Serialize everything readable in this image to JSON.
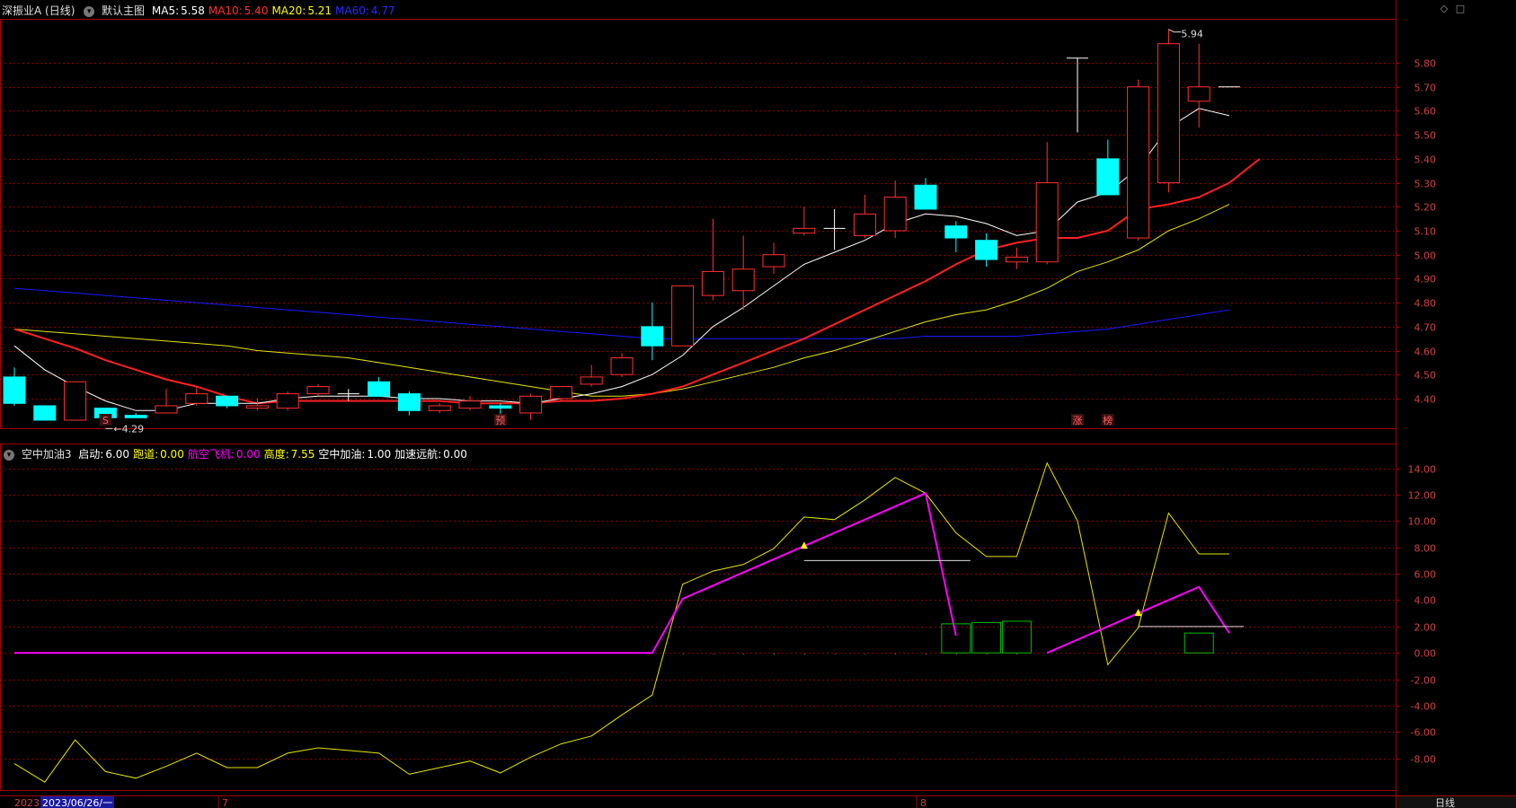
{
  "header": {
    "stock": "深振业A (日线)",
    "template": "默认主图",
    "ma": [
      {
        "label": "MA5:",
        "value": "5.58",
        "color": "#ffffff"
      },
      {
        "label": "MA10:",
        "value": "5.40",
        "color": "#ff3030"
      },
      {
        "label": "MA20:",
        "value": "5.21",
        "color": "#ffff00"
      },
      {
        "label": "MA60:",
        "value": "4.77",
        "color": "#2a2aff"
      }
    ]
  },
  "indicator_header": {
    "name": "空中加油3",
    "items": [
      {
        "label": "启动:",
        "value": "6.00",
        "color": "#ffffff"
      },
      {
        "label": "跑道:",
        "value": "0.00",
        "color": "#ffff00"
      },
      {
        "label": "航空飞机:",
        "value": "0.00",
        "color": "#ff00ff"
      },
      {
        "label": "高度:",
        "value": "7.55",
        "color": "#ffff00"
      },
      {
        "label": "空中加油:",
        "value": "1.00",
        "color": "#ffffff"
      },
      {
        "label": "加速远航:",
        "value": "0.00",
        "color": "#ffffff"
      }
    ]
  },
  "chart_data": [
    {
      "type": "candlestick",
      "ylim": [
        4.28,
        5.98
      ],
      "yticks": [
        "5.80",
        "5.70",
        "5.60",
        "5.50",
        "5.40",
        "5.30",
        "5.20",
        "5.10",
        "5.00",
        "4.90",
        "4.80",
        "4.70",
        "4.60",
        "4.50",
        "4.40"
      ],
      "candles": [
        [
          4.49,
          4.38,
          4.53,
          4.37
        ],
        [
          4.37,
          4.31,
          4.37,
          4.31
        ],
        [
          4.31,
          4.47,
          4.47,
          4.31
        ],
        [
          4.36,
          4.32,
          4.36,
          4.32
        ],
        [
          4.33,
          4.32,
          4.34,
          4.32
        ],
        [
          4.34,
          4.37,
          4.44,
          4.34
        ],
        [
          4.38,
          4.42,
          4.45,
          4.37
        ],
        [
          4.41,
          4.37,
          4.41,
          4.36
        ],
        [
          4.36,
          4.37,
          4.4,
          4.35
        ],
        [
          4.36,
          4.42,
          4.43,
          4.35
        ],
        [
          4.42,
          4.45,
          4.46,
          4.41
        ],
        [
          4.42,
          4.42,
          4.44,
          4.39
        ],
        [
          4.47,
          4.41,
          4.49,
          4.41
        ],
        [
          4.42,
          4.35,
          4.43,
          4.33
        ],
        [
          4.35,
          4.37,
          4.38,
          4.34
        ],
        [
          4.36,
          4.39,
          4.41,
          4.35
        ],
        [
          4.37,
          4.36,
          4.38,
          4.31
        ],
        [
          4.34,
          4.41,
          4.42,
          4.31
        ],
        [
          4.4,
          4.45,
          4.45,
          4.39
        ],
        [
          4.46,
          4.49,
          4.54,
          4.45
        ],
        [
          4.5,
          4.57,
          4.59,
          4.49
        ],
        [
          4.7,
          4.62,
          4.8,
          4.56
        ],
        [
          4.62,
          4.87,
          4.87,
          4.62
        ],
        [
          4.83,
          4.93,
          5.15,
          4.81
        ],
        [
          4.85,
          4.94,
          5.08,
          4.77
        ],
        [
          4.95,
          5.0,
          5.05,
          4.92
        ],
        [
          5.09,
          5.11,
          5.2,
          5.08
        ],
        [
          5.11,
          5.11,
          5.19,
          5.02
        ],
        [
          5.08,
          5.17,
          5.25,
          5.07
        ],
        [
          5.1,
          5.24,
          5.31,
          5.07
        ],
        [
          5.29,
          5.19,
          5.32,
          5.19
        ],
        [
          5.12,
          5.07,
          5.14,
          5.01
        ],
        [
          5.06,
          4.98,
          5.09,
          4.95
        ],
        [
          4.97,
          4.99,
          5.03,
          4.94
        ],
        [
          4.97,
          5.3,
          5.47,
          4.96
        ],
        [
          5.82,
          5.82,
          5.82,
          5.51
        ],
        [
          5.4,
          5.25,
          5.48,
          5.25
        ],
        [
          5.07,
          5.7,
          5.73,
          5.06
        ],
        [
          5.3,
          5.88,
          5.94,
          5.26
        ],
        [
          5.64,
          5.7,
          5.88,
          5.53
        ],
        [
          5.7,
          5.7,
          5.7,
          5.7
        ]
      ],
      "ma5": [
        4.62,
        4.52,
        4.45,
        4.39,
        4.35,
        4.35,
        4.38,
        4.38,
        4.38,
        4.4,
        4.41,
        4.41,
        4.41,
        4.4,
        4.4,
        4.39,
        4.39,
        4.38,
        4.4,
        4.42,
        4.45,
        4.5,
        4.58,
        4.7,
        4.78,
        4.87,
        4.96,
        5.01,
        5.06,
        5.13,
        5.17,
        5.16,
        5.13,
        5.08,
        5.1,
        5.22,
        5.26,
        5.36,
        5.53,
        5.61,
        5.58
      ],
      "ma10": [
        4.69,
        4.65,
        4.61,
        4.56,
        4.52,
        4.48,
        4.45,
        4.41,
        4.38,
        4.39,
        4.39,
        4.39,
        4.39,
        4.39,
        4.39,
        4.38,
        4.38,
        4.38,
        4.39,
        4.39,
        4.4,
        4.42,
        4.45,
        4.5,
        4.55,
        4.6,
        4.65,
        4.71,
        4.77,
        4.83,
        4.89,
        4.96,
        5.02,
        5.05,
        5.07,
        5.07,
        5.1,
        5.19,
        5.21,
        5.24,
        5.3,
        5.4
      ],
      "ma20": [
        4.69,
        4.68,
        4.67,
        4.66,
        4.65,
        4.64,
        4.63,
        4.62,
        4.6,
        4.59,
        4.58,
        4.57,
        4.55,
        4.53,
        4.51,
        4.49,
        4.47,
        4.45,
        4.43,
        4.41,
        4.41,
        4.42,
        4.44,
        4.47,
        4.5,
        4.53,
        4.57,
        4.6,
        4.64,
        4.68,
        4.72,
        4.75,
        4.77,
        4.81,
        4.86,
        4.93,
        4.97,
        5.02,
        5.1,
        5.15,
        5.21
      ],
      "ma60": [
        4.86,
        4.85,
        4.84,
        4.83,
        4.82,
        4.81,
        4.8,
        4.79,
        4.78,
        4.77,
        4.76,
        4.75,
        4.74,
        4.73,
        4.72,
        4.71,
        4.7,
        4.69,
        4.68,
        4.67,
        4.66,
        4.65,
        4.65,
        4.65,
        4.65,
        4.65,
        4.65,
        4.65,
        4.65,
        4.65,
        4.66,
        4.66,
        4.66,
        4.66,
        4.67,
        4.68,
        4.69,
        4.71,
        4.73,
        4.75,
        4.77
      ],
      "high_label": "5.94",
      "low_label": "4.29",
      "bottom_marks": [
        {
          "index": 3,
          "text": "S"
        },
        {
          "index": 16,
          "text": "预"
        },
        {
          "index": 35,
          "text": "涨"
        },
        {
          "index": 36,
          "text": "榜"
        }
      ]
    },
    {
      "type": "line",
      "ylim": [
        -10.4,
        15.6
      ],
      "yticks": [
        "14.00",
        "12.00",
        "10.00",
        "8.00",
        "6.00",
        "4.00",
        "2.00",
        "0.00",
        "-2.00",
        "-4.00",
        "-6.00",
        "-8.00"
      ],
      "series": [
        {
          "values": [
            -8.4,
            -9.8,
            -6.6,
            -9.0,
            -9.5,
            -8.6,
            -7.6,
            -8.7,
            -8.7,
            -7.6,
            -7.2,
            -7.4,
            -7.6,
            -9.2,
            -8.7,
            -8.2,
            -9.1,
            -7.9,
            -6.9,
            -6.3,
            -4.7,
            -3.2,
            5.2,
            6.2,
            6.7,
            7.9,
            10.3,
            10.1,
            11.6,
            13.3,
            12.1,
            9.1,
            7.3,
            7.3,
            14.4,
            10.0,
            -0.9,
            1.9,
            10.6,
            7.5,
            7.5
          ]
        },
        {
          "values": [
            0,
            0,
            0,
            0,
            0,
            0,
            0,
            0,
            0,
            0,
            0,
            0,
            0,
            0,
            0,
            0,
            0,
            0,
            0,
            0,
            0,
            0,
            4.1,
            5.1,
            6.1,
            7.1,
            8.1,
            9.1,
            10.1,
            11.1,
            12.1,
            1.3,
            null,
            null,
            0,
            1.0,
            2.0,
            3.0,
            4.0,
            5.0,
            1.5
          ]
        }
      ],
      "markers": [
        {
          "index": 26,
          "value": 8.1
        },
        {
          "index": 37,
          "value": 3.0
        }
      ],
      "ref_lines": [
        {
          "from": 26,
          "to": 31,
          "value": 7.0
        },
        {
          "from": 37,
          "to": 40,
          "value": 2.0
        }
      ],
      "boxes": [
        {
          "index": 31,
          "value": 2.2
        },
        {
          "index": 32,
          "value": 2.3
        },
        {
          "index": 33,
          "value": 2.4
        },
        {
          "index": 39,
          "value": 1.5
        }
      ]
    }
  ],
  "footer": {
    "year": "2023",
    "date": "2023/06/26/一",
    "month7": "7",
    "month8": "8",
    "period": "日线"
  },
  "colors": {
    "up": "#ff3030",
    "down": "#00ffff",
    "grid": "#8b0000",
    "axis": "#a00000",
    "ma5": "#ffffff",
    "ma10": "#ff2020",
    "ma20": "#e6e600",
    "ma60": "#1a1aff",
    "osc": "#e6e600",
    "purple": "#ff00ff",
    "box": "#00c000"
  }
}
